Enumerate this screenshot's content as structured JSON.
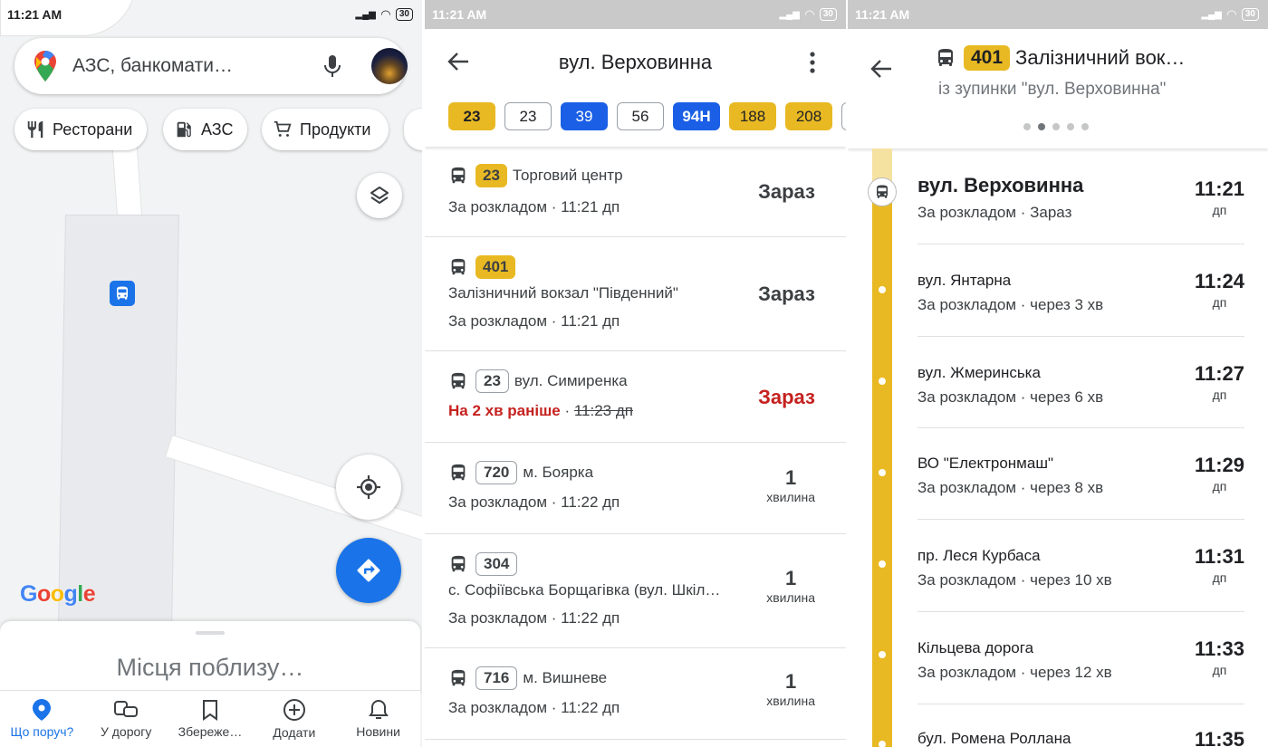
{
  "status": {
    "time": "11:21 AM",
    "battery": "30"
  },
  "map": {
    "search_placeholder": "АЗС, банкомати…",
    "chips": [
      "Ресторани",
      "АЗС",
      "Продукти"
    ],
    "google_logo": "Google",
    "sheet_title": "Місця поблизу…",
    "nav": [
      "Що поруч?",
      "У дорогу",
      "Збереже…",
      "Додати",
      "Новини"
    ],
    "colors": {
      "accent": "#1a73e8",
      "bus_stop": "#1a73e8"
    }
  },
  "stop": {
    "title": "вул. Верховинна",
    "routes": [
      "23",
      "23",
      "39",
      "56",
      "94Н",
      "188",
      "208"
    ],
    "departures": [
      {
        "route": "23",
        "dest": "Торговий центр",
        "line2": "За розкладом · 11:21 дп",
        "when": "Зараз",
        "unit": ""
      },
      {
        "route": "401",
        "dest": "Залізничний вокзал \"Південний\"",
        "line2": "За розкладом · 11:21 дп",
        "when": "Зараз",
        "unit": ""
      },
      {
        "route": "23",
        "dest": "вул. Симиренка",
        "early": "На 2 хв раніше",
        "old_time": "11:23 дп",
        "when": "Зараз",
        "unit": ""
      },
      {
        "route": "720",
        "dest": "м. Боярка",
        "line2": "За розкладом · 11:22 дп",
        "when": "1",
        "unit": "хвилина"
      },
      {
        "route": "304",
        "dest": "с. Софіївська Борщагівка (вул. Шкіл…",
        "line2": "За розкладом · 11:22 дп",
        "when": "1",
        "unit": "хвилина"
      },
      {
        "route": "716",
        "dest": "м. Вишневе",
        "line2": "За розкладом · 11:22 дп",
        "when": "1",
        "unit": "хвилина"
      }
    ],
    "colors": {
      "late_red": "#c5221f",
      "route_yellow": "#e8b923",
      "route_blue": "#1a5fe6"
    }
  },
  "trip": {
    "route": "401",
    "title": "Залізничний вок…",
    "subtitle": "із зупинки \"вул. Верховинна\"",
    "stops": [
      {
        "name": "вул. Верховинна",
        "sub": "За розкладом · Зараз",
        "time": "11:21",
        "ampm": "дп"
      },
      {
        "name": "вул. Янтарна",
        "sub": "За розкладом · через 3 хв",
        "time": "11:24",
        "ampm": "дп"
      },
      {
        "name": "вул. Жмеринська",
        "sub": "За розкладом · через 6 хв",
        "time": "11:27",
        "ampm": "дп"
      },
      {
        "name": "ВО \"Електронмаш\"",
        "sub": "За розкладом · через 8 хв",
        "time": "11:29",
        "ampm": "дп"
      },
      {
        "name": "пр. Леся Курбаса",
        "sub": "За розкладом · через 10 хв",
        "time": "11:31",
        "ampm": "дп"
      },
      {
        "name": "Кільцева дорога",
        "sub": "За розкладом · через 12 хв",
        "time": "11:33",
        "ampm": "дп"
      },
      {
        "name": "бул. Ромена Роллана",
        "sub": "",
        "time": "11:35",
        "ampm": ""
      }
    ]
  }
}
